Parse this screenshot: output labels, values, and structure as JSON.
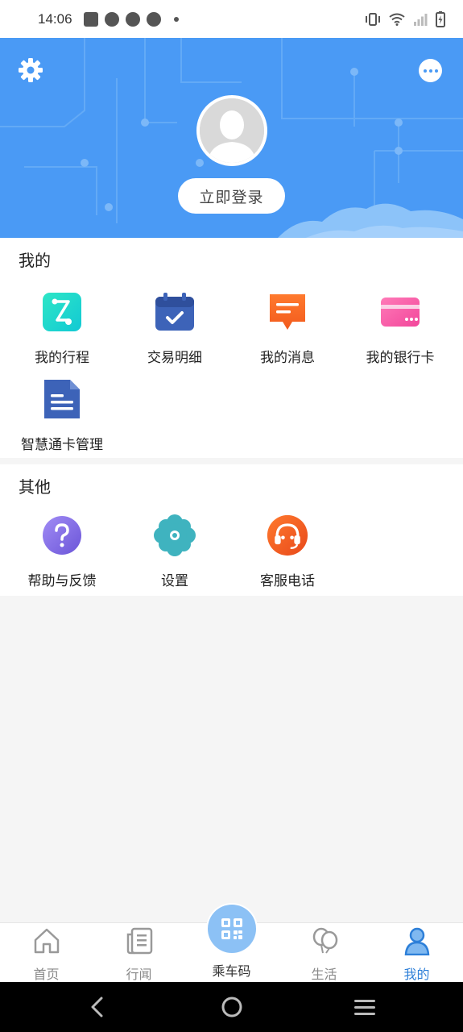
{
  "status_bar": {
    "time": "14:06"
  },
  "header": {
    "login_label": "立即登录",
    "banner_color": "#4a9af5"
  },
  "sections": {
    "mine": {
      "title": "我的",
      "items": [
        {
          "label": "我的行程",
          "icon": "trip-route-icon"
        },
        {
          "label": "交易明细",
          "icon": "calendar-check-icon"
        },
        {
          "label": "我的消息",
          "icon": "message-bubble-icon"
        },
        {
          "label": "我的银行卡",
          "icon": "bank-card-icon"
        },
        {
          "label": "智慧通卡管理",
          "icon": "document-icon"
        }
      ]
    },
    "other": {
      "title": "其他",
      "items": [
        {
          "label": "帮助与反馈",
          "icon": "help-question-icon"
        },
        {
          "label": "设置",
          "icon": "settings-flower-icon"
        },
        {
          "label": "客服电话",
          "icon": "customer-service-headset-icon"
        }
      ]
    }
  },
  "bottom_nav": {
    "items": [
      {
        "label": "首页",
        "icon": "home-icon"
      },
      {
        "label": "行闻",
        "icon": "news-icon"
      },
      {
        "label": "乘车码",
        "icon": "qr-code-icon"
      },
      {
        "label": "生活",
        "icon": "balloons-icon"
      },
      {
        "label": "我的",
        "icon": "profile-icon"
      }
    ],
    "active_color": "#2d7fd8",
    "inactive_color": "#888888"
  }
}
